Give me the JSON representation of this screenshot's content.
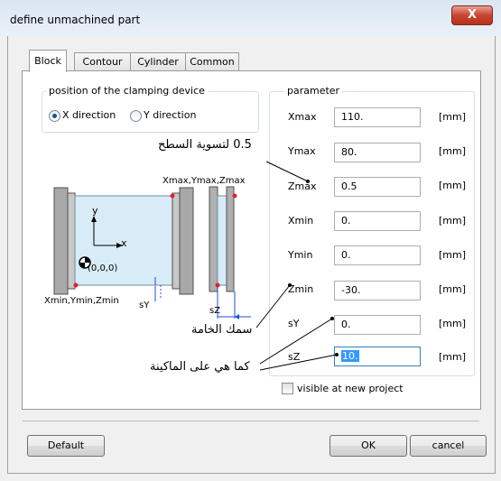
{
  "window": {
    "title": "define unmachined part",
    "close_glyph": "X"
  },
  "tabs": [
    {
      "label": "Block",
      "active": true
    },
    {
      "label": "Contour",
      "active": false
    },
    {
      "label": "Cylinder",
      "active": false
    },
    {
      "label": "Common",
      "active": false
    }
  ],
  "clamping": {
    "group_title": "position of the clamping device",
    "options": [
      {
        "label": "X direction",
        "selected": true
      },
      {
        "label": "Y direction",
        "selected": false
      }
    ]
  },
  "diagram": {
    "top_right_label": "Xmax,Ymax,Zmax",
    "bottom_left_label": "Xmin,Ymin,Zmin",
    "origin_label": "(0,0,0)",
    "y_axis": "y",
    "x_axis": "x",
    "sy_label": "sY",
    "sz_label": "sZ"
  },
  "parameter": {
    "group_title": "parameter",
    "rows": [
      {
        "label": "Xmax",
        "value": "110.",
        "unit": "[mm]"
      },
      {
        "label": "Ymax",
        "value": "80.",
        "unit": "[mm]"
      },
      {
        "label": "Zmax",
        "value": "0.5",
        "unit": "[mm]"
      },
      {
        "label": "Xmin",
        "value": "0.",
        "unit": "[mm]"
      },
      {
        "label": "Ymin",
        "value": "0.",
        "unit": "[mm]"
      },
      {
        "label": "Zmin",
        "value": "-30.",
        "unit": "[mm]"
      },
      {
        "label": "sY",
        "value": "0.",
        "unit": "[mm]"
      },
      {
        "label": "sZ",
        "value": "10.",
        "unit": "[mm]"
      }
    ]
  },
  "visible_checkbox": {
    "label": "visible at new project",
    "checked": false
  },
  "buttons": {
    "default": "Default",
    "ok": "OK",
    "cancel": "cancel"
  },
  "annotations": {
    "zmax_note": "0.5 لتسوية السطح",
    "zmin_note": "سمك الخامة",
    "sz_note": "كما هي على الماكينة"
  },
  "colors": {
    "selection": "#3399ff",
    "close_button": "#c8452f",
    "marker": "#e0202a"
  }
}
